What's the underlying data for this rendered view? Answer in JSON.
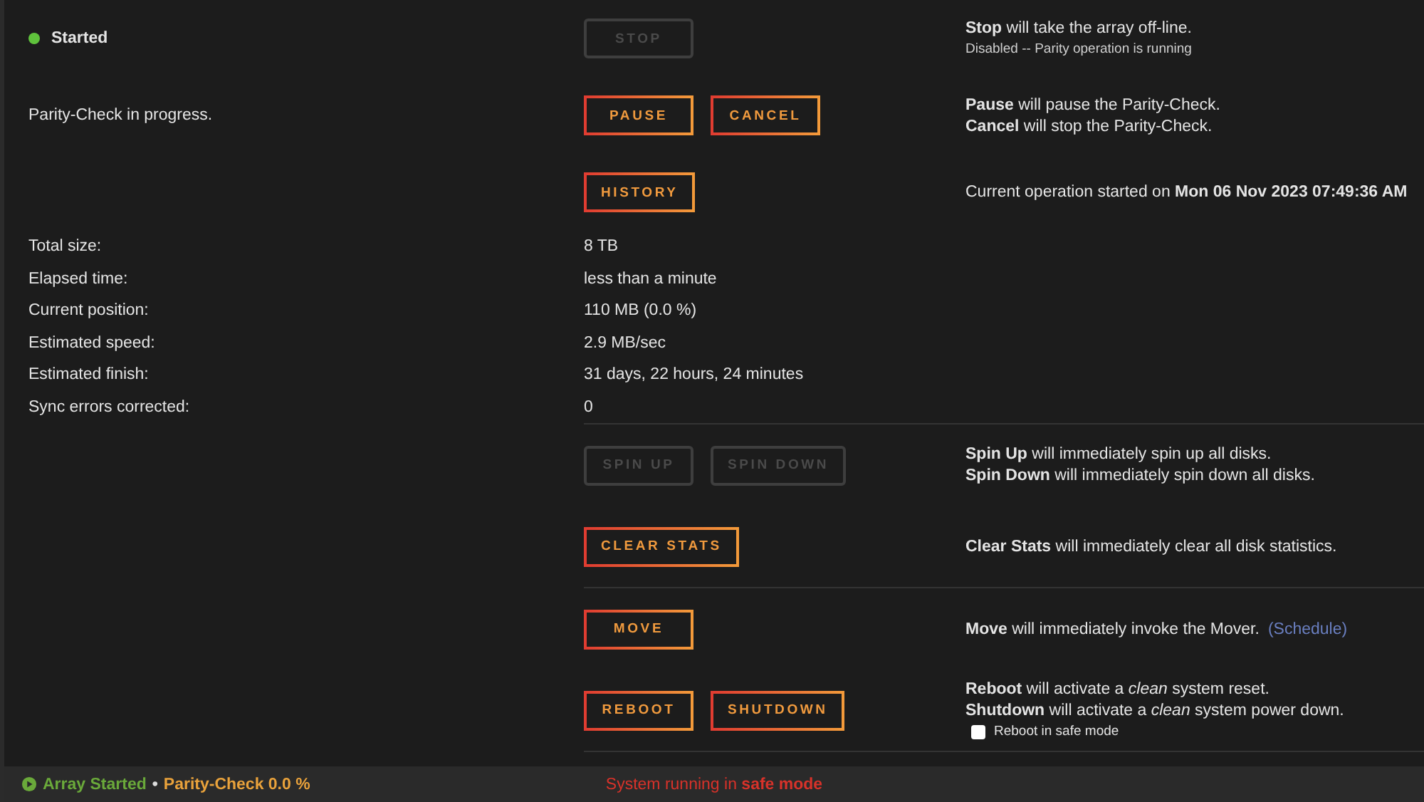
{
  "top_rows": [
    {
      "label": "Started",
      "color": "#5fc23c",
      "buttons": [
        {
          "label": "STOP",
          "disabled": true
        }
      ],
      "notes": [
        "**Stop** will take the array off-line."
      ],
      "small_note": "Disabled -- Parity operation is running"
    },
    {
      "label": "Parity-Check in progress.",
      "buttons": [
        {
          "label": "PAUSE",
          "disabled": false
        },
        {
          "label": "CANCEL",
          "disabled": false
        }
      ],
      "notes": [
        "**Pause** will pause the Parity-Check.",
        "**Cancel** will stop the Parity-Check."
      ]
    },
    {
      "buttons": [
        {
          "label": "HISTORY",
          "disabled": false
        }
      ],
      "notes": [
        "Current operation started on **Mon 06 Nov 2023 07:49:36 AM**"
      ]
    }
  ],
  "stats": [
    {
      "label": "Total size:",
      "value": "8 TB"
    },
    {
      "label": "Elapsed time:",
      "value": "less than a minute"
    },
    {
      "label": "Current position:",
      "value": "110 MB (0.0 %)"
    },
    {
      "label": "Estimated speed:",
      "value": "2.9 MB/sec"
    },
    {
      "label": "Estimated finish:",
      "value": "31 days, 22 hours, 24 minutes"
    },
    {
      "label": "Sync errors corrected:",
      "value": "0"
    }
  ],
  "groups": [
    [
      {
        "buttons": [
          {
            "label": "SPIN UP",
            "disabled": true
          },
          {
            "label": "SPIN DOWN",
            "disabled": true
          }
        ],
        "notes": [
          "**Spin Up** will immediately spin up all disks.",
          "**Spin Down** will immediately spin down all disks."
        ]
      },
      {
        "buttons": [
          {
            "label": "CLEAR STATS",
            "disabled": false
          }
        ],
        "notes": [
          "**Clear Stats** will immediately clear all disk statistics."
        ]
      }
    ],
    [
      {
        "buttons": [
          {
            "label": "MOVE",
            "disabled": false
          }
        ],
        "notes": [
          "**Move** will immediately invoke the Mover."
        ],
        "link": "(Schedule)"
      },
      {
        "buttons": [
          {
            "label": "REBOOT",
            "disabled": false
          },
          {
            "label": "SHUTDOWN",
            "disabled": false
          }
        ],
        "notes": [
          "**Reboot** will activate a *clean* system reset.",
          "**Shutdown** will activate a *clean* system power down."
        ],
        "checkbox": {
          "label": "Reboot in safe mode",
          "checked": false
        }
      }
    ]
  ],
  "footer": {
    "array_status": "Array Started",
    "separator": "•",
    "parity": "Parity-Check 0.0 %",
    "message": "System running in **safe mode**"
  }
}
